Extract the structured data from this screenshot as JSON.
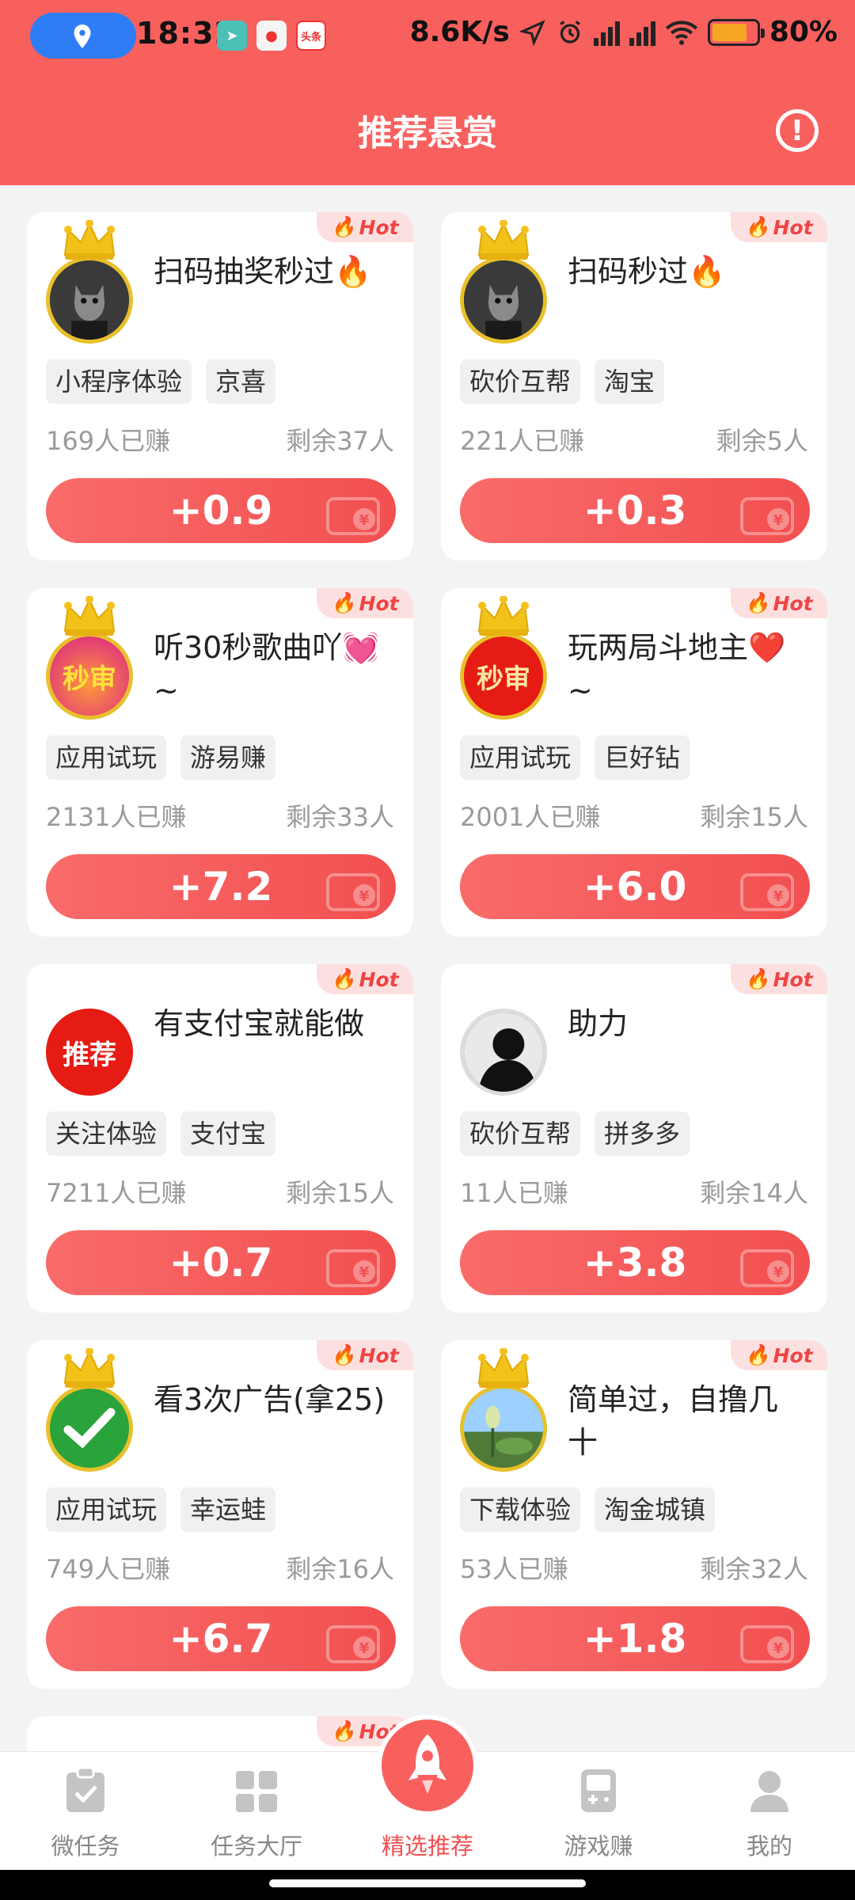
{
  "status_bar": {
    "time": "18:32",
    "network_speed": "8.6K/s",
    "battery": "80%",
    "app_badge_label": "头条"
  },
  "header": {
    "title": "推荐悬赏"
  },
  "hot_label": "Hot",
  "cards": [
    {
      "title": "扫码抽奖秒过🔥",
      "tags": [
        "小程序体验",
        "京喜"
      ],
      "earned": "169人已赚",
      "remain": "剩余37人",
      "reward": "+0.9"
    },
    {
      "title": "扫码秒过🔥",
      "tags": [
        "砍价互帮",
        "淘宝"
      ],
      "earned": "221人已赚",
      "remain": "剩余5人",
      "reward": "+0.3"
    },
    {
      "title": "听30秒歌曲吖💓~",
      "tags": [
        "应用试玩",
        "游易赚"
      ],
      "earned": "2131人已赚",
      "remain": "剩余33人",
      "reward": "+7.2",
      "avatar_text": "秒审"
    },
    {
      "title": "玩两局斗地主❤️~",
      "tags": [
        "应用试玩",
        "巨好钻"
      ],
      "earned": "2001人已赚",
      "remain": "剩余15人",
      "reward": "+6.0",
      "avatar_text": "秒审"
    },
    {
      "title": "有支付宝就能做",
      "tags": [
        "关注体验",
        "支付宝"
      ],
      "earned": "7211人已赚",
      "remain": "剩余15人",
      "reward": "+0.7",
      "avatar_text": "推荐"
    },
    {
      "title": "助力",
      "tags": [
        "砍价互帮",
        "拼多多"
      ],
      "earned": "11人已赚",
      "remain": "剩余14人",
      "reward": "+3.8"
    },
    {
      "title": "看3次广告(拿25)",
      "tags": [
        "应用试玩",
        "幸运蛙"
      ],
      "earned": "749人已赚",
      "remain": "剩余16人",
      "reward": "+6.7"
    },
    {
      "title": "简单过，自撸几十",
      "tags": [
        "下载体验",
        "淘金城镇"
      ],
      "earned": "53人已赚",
      "remain": "剩余32人",
      "reward": "+1.8"
    }
  ],
  "tabbar": {
    "items": [
      {
        "label": "微任务"
      },
      {
        "label": "任务大厅"
      },
      {
        "label": "精选推荐"
      },
      {
        "label": "游戏赚"
      },
      {
        "label": "我的"
      }
    ]
  },
  "colors": {
    "brand": "#f8605e",
    "button": "#f24f50",
    "hot_bg": "#fce0df"
  }
}
